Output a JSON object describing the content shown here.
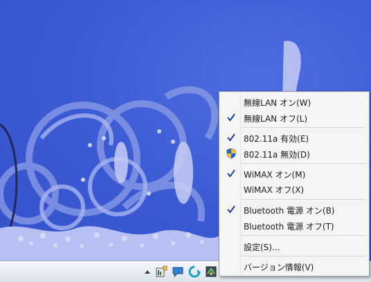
{
  "menu": {
    "items": [
      {
        "label": "無線LAN オン(W)",
        "checked": false
      },
      {
        "label": "無線LAN オフ(L)",
        "checked": true
      },
      {
        "label": "802.11a 有効(E)",
        "checked": true
      },
      {
        "label": "802.11a 無効(D)",
        "checked": false,
        "icon": "uac-shield-icon"
      },
      {
        "label": "WiMAX オン(M)",
        "checked": true
      },
      {
        "label": "WiMAX オフ(X)",
        "checked": false
      },
      {
        "label": "Bluetooth 電源 オン(B)",
        "checked": true
      },
      {
        "label": "Bluetooth 電源 オフ(T)",
        "checked": false
      },
      {
        "label": "設定(S)...",
        "checked": false
      },
      {
        "label": "バージョン情報(V)",
        "checked": false
      }
    ]
  },
  "taskbar": {
    "tray_icons": [
      "show-hidden-icons-arrow",
      "network-status-icon",
      "message-icon",
      "sync-icon",
      "wireless-utility-icon"
    ]
  },
  "colors": {
    "desktop": "#3a5ad3",
    "check": "#1b3f9e"
  }
}
